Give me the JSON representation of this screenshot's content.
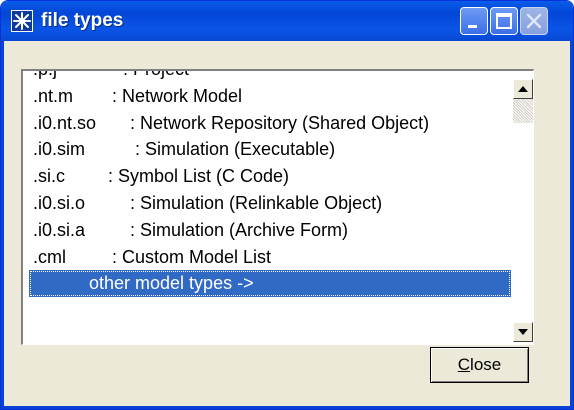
{
  "window": {
    "title": "file types",
    "colors": {
      "titlebar": "#0a55e6",
      "selection": "#316ac5",
      "face": "#ece9d8"
    }
  },
  "titlebar_buttons": [
    {
      "name": "minimize",
      "icon": "minimize-icon"
    },
    {
      "name": "maximize",
      "icon": "maximize-icon"
    },
    {
      "name": "close",
      "icon": "close-icon",
      "disabled": true
    }
  ],
  "list": {
    "partial_top": {
      "ext": ".p.j",
      "desc": ": Project"
    },
    "items": [
      {
        "ext": ".nt.m",
        "desc": ": Network Model"
      },
      {
        "ext": ".i0.nt.so",
        "desc": ": Network Repository (Shared Object)"
      },
      {
        "ext": ".i0.sim",
        "desc": ": Simulation (Executable)"
      },
      {
        "ext": ".si.c",
        "desc": ": Symbol List (C Code)"
      },
      {
        "ext": ".i0.si.o",
        "desc": ": Simulation (Relinkable Object)"
      },
      {
        "ext": ".i0.si.a",
        "desc": ": Simulation (Archive Form)"
      },
      {
        "ext": ".cml",
        "desc": ": Custom Model List"
      }
    ],
    "selected_label": "other model types ->"
  },
  "buttons": {
    "close_mnemonic": "C",
    "close_rest": "lose"
  }
}
